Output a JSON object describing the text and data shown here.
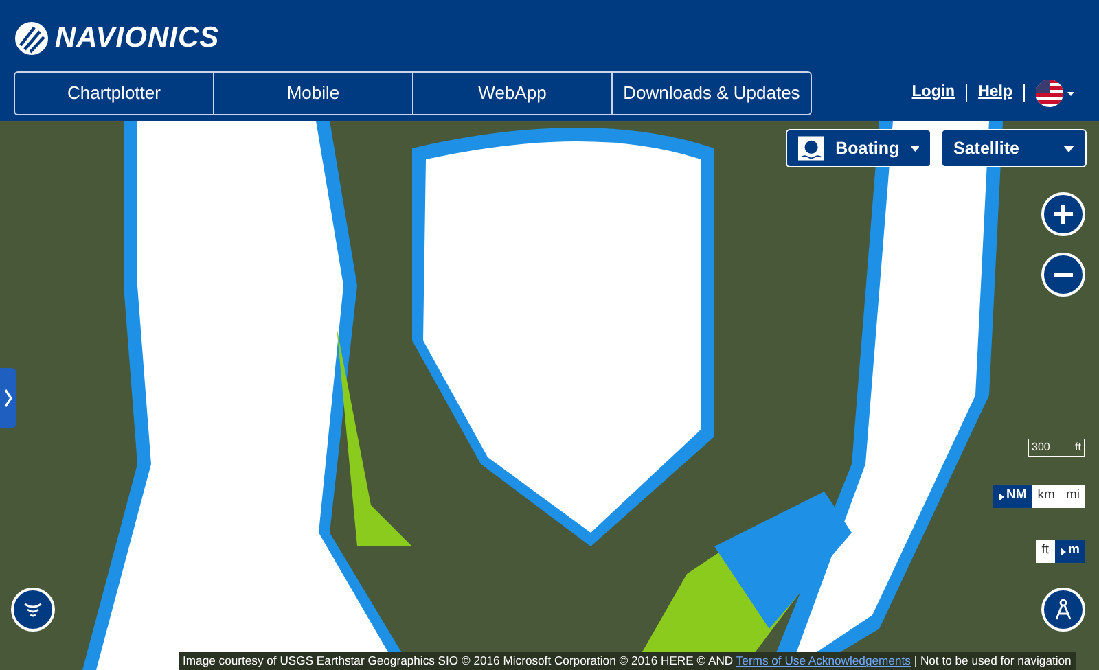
{
  "header": {
    "logo": "NAVIONICS",
    "nav_tabs": [
      {
        "label": "Chartplotter"
      },
      {
        "label": "Mobile"
      },
      {
        "label": "WebApp"
      },
      {
        "label": "Downloads & Updates"
      }
    ],
    "links": [
      {
        "label": "Login"
      },
      {
        "label": "Help"
      }
    ]
  },
  "map": {
    "mode_dropdown": "Boating",
    "layer_dropdown": "Satellite",
    "scale": {
      "value": "300",
      "unit": "ft"
    },
    "distance_units": [
      {
        "label": "NM",
        "selected": true
      },
      {
        "label": "km",
        "selected": false
      },
      {
        "label": "mi",
        "selected": false
      }
    ],
    "depth_units": [
      {
        "label": "ft",
        "selected": false
      },
      {
        "label": "m",
        "selected": true
      }
    ],
    "attribution": {
      "text": "Image courtesy of USGS Earthstar Geographics SIO © 2016 Microsoft Corporation © 2016 HERE © AND",
      "link": "Terms of Use Acknowledgements",
      "note": "| Not to be used for navigation"
    }
  }
}
